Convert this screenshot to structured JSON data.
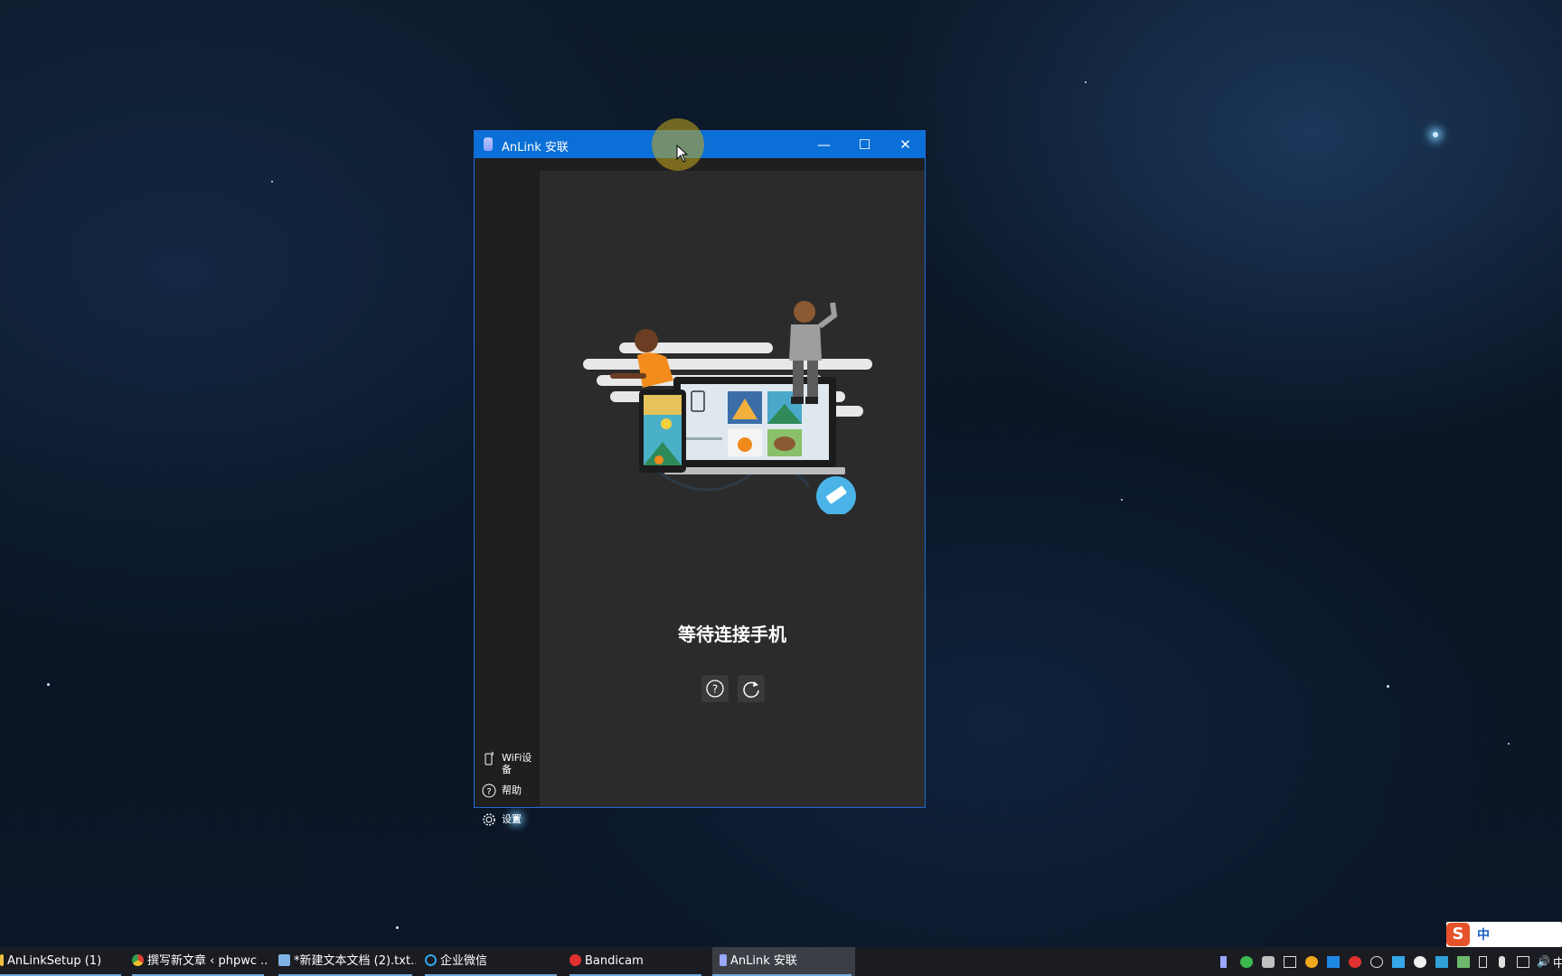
{
  "window": {
    "title": "AnLink 安联",
    "controls": {
      "minimize": "—",
      "maximize": "☐",
      "close": "✕"
    }
  },
  "sidebar": {
    "items": [
      {
        "label": "WiFi设备",
        "icon": "phone-wifi-icon"
      },
      {
        "label": "帮助",
        "icon": "help-circle-icon"
      },
      {
        "label": "设置",
        "icon": "gear-icon"
      }
    ]
  },
  "main": {
    "status_text": "等待连接手机",
    "help_icon": "help-circle-icon",
    "refresh_icon": "refresh-icon"
  },
  "taskbar": {
    "tasks": [
      {
        "label": "AnLinkSetup (1)",
        "icon": "folder-icon",
        "color": "#f0c040"
      },
      {
        "label": "撰写新文章 ‹ phpwc ...",
        "icon": "chrome-icon",
        "color": "#e0a020"
      },
      {
        "label": "*新建文本文档 (2).txt...",
        "icon": "notepad-icon",
        "color": "#7fb2e6"
      },
      {
        "label": "企业微信",
        "icon": "wecom-icon",
        "color": "#35a7e8"
      },
      {
        "label": "Bandicam",
        "icon": "record-icon",
        "color": "#e03030"
      },
      {
        "label": "AnLink 安联",
        "icon": "anlink-icon",
        "color": "#9aa8ff"
      }
    ],
    "tray_clock": "中",
    "ime_mode": "中"
  },
  "colors": {
    "titlebar": "#0a6fd6",
    "content_bg": "#2b2b2b",
    "sidebar_bg": "#1f1f1f",
    "accent": "#1e6bd6"
  }
}
